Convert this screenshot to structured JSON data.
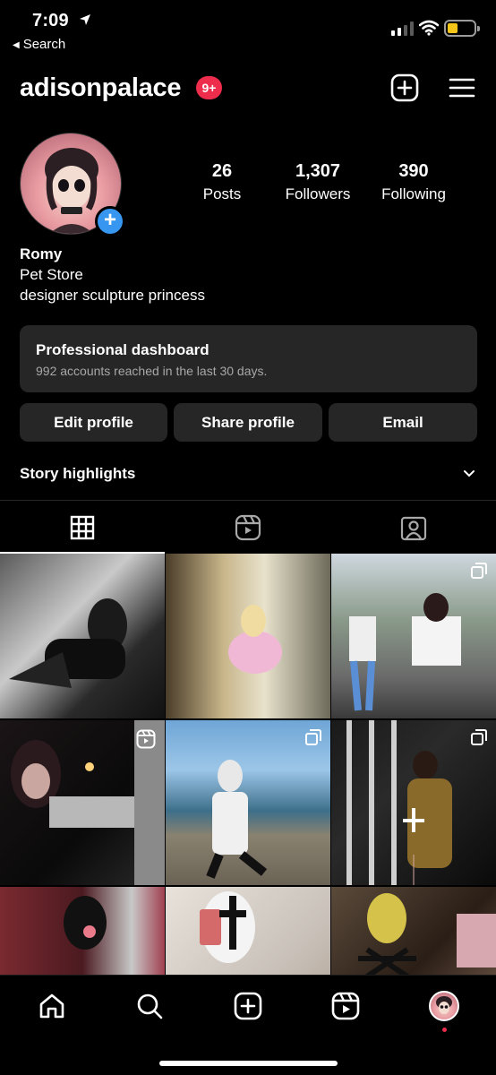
{
  "status_bar": {
    "time": "7:09",
    "back_label": "Search"
  },
  "header": {
    "username": "adisonpalace",
    "notification_badge": "9+"
  },
  "profile": {
    "stats": [
      {
        "value": "26",
        "label": "Posts"
      },
      {
        "value": "1,307",
        "label": "Followers"
      },
      {
        "value": "390",
        "label": "Following"
      }
    ],
    "name": "Romy",
    "category": "Pet Store",
    "bio": "designer sculpture princess"
  },
  "dashboard": {
    "title": "Professional dashboard",
    "subtitle": "992 accounts reached in the last 30 days."
  },
  "buttons": {
    "edit": "Edit profile",
    "share": "Share profile",
    "email": "Email"
  },
  "highlights": {
    "label": "Story highlights"
  },
  "tabs": [
    "grid-icon",
    "reels-icon",
    "tagged-icon"
  ],
  "colors": {
    "accent": "#3797f0",
    "badge": "#ed2d4b",
    "surface": "#262626",
    "battery": "#f5c518"
  },
  "grid": [
    {
      "badge": "none"
    },
    {
      "badge": "none"
    },
    {
      "badge": "carousel"
    },
    {
      "badge": "reel"
    },
    {
      "badge": "carousel"
    },
    {
      "badge": "carousel"
    },
    {
      "badge": "none"
    },
    {
      "badge": "none"
    },
    {
      "badge": "none"
    }
  ]
}
